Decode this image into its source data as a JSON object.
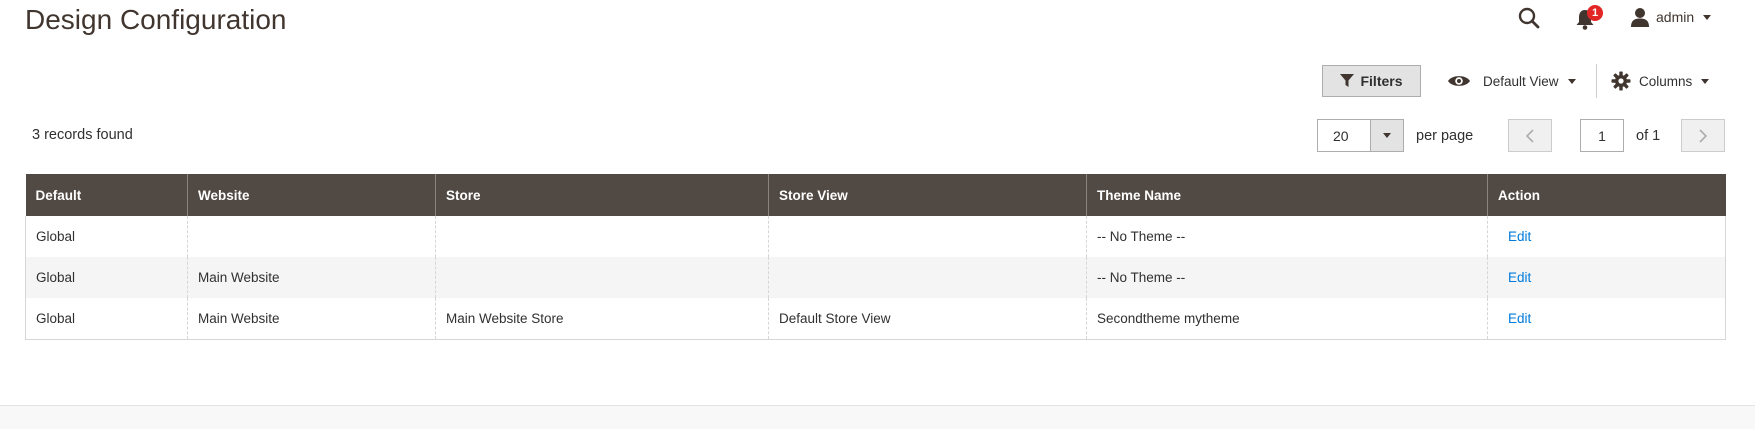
{
  "page": {
    "title": "Design Configuration"
  },
  "header": {
    "notifications_count": "1",
    "user_name": "admin"
  },
  "toolbar": {
    "filters_label": "Filters",
    "view_label": "Default View",
    "columns_label": "Columns"
  },
  "pager": {
    "records_found": "3 records found",
    "per_page_value": "20",
    "per_page_label": "per page",
    "current_page": "1",
    "of_pages": "of 1"
  },
  "grid": {
    "columns": [
      "Default",
      "Website",
      "Store",
      "Store View",
      "Theme Name",
      "Action"
    ],
    "rows": [
      {
        "default": "Global",
        "website": "",
        "store": "",
        "store_view": "",
        "theme": "-- No Theme --",
        "action": "Edit"
      },
      {
        "default": "Global",
        "website": "Main Website",
        "store": "",
        "store_view": "",
        "theme": "-- No Theme --",
        "action": "Edit"
      },
      {
        "default": "Global",
        "website": "Main Website",
        "store": "Main Website Store",
        "store_view": "Default Store View",
        "theme": "Secondtheme mytheme",
        "action": "Edit"
      }
    ]
  },
  "icons": {
    "search": "search-icon",
    "notifications": "bell-icon",
    "user": "user-icon",
    "filter": "filter-icon",
    "view": "eye-icon",
    "columns": "gear-icon"
  },
  "colors": {
    "header_bg": "#514943",
    "link": "#007bdb",
    "badge": "#e22626"
  }
}
